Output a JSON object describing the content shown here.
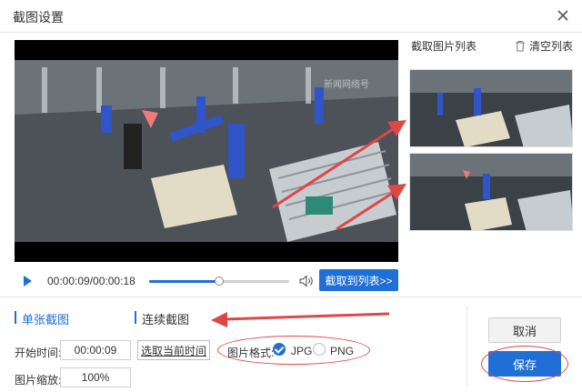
{
  "window": {
    "title": "截图设置"
  },
  "video": {
    "watermark": "新闻网络号"
  },
  "list": {
    "title": "截取图片列表",
    "clear_label": "清空列表"
  },
  "player": {
    "timecode": "00:00:09/00:00:18",
    "progress": 0.5,
    "capture_label": "截取到列表>>"
  },
  "tabs": {
    "single": "单张截图",
    "continuous": "连续截图"
  },
  "form": {
    "start_time_label": "开始时间:",
    "start_time_value": "00:00:09",
    "pick_current_label": "选取当前时间",
    "scale_label": "图片缩放:",
    "scale_value": "100%",
    "format_label": "图片格式:",
    "format_jpg": "JPG",
    "format_png": "PNG",
    "format_selected": "JPG"
  },
  "buttons": {
    "cancel": "取消",
    "save": "保存"
  },
  "colors": {
    "accent": "#1f6fd6",
    "annotation": "#e04646"
  }
}
